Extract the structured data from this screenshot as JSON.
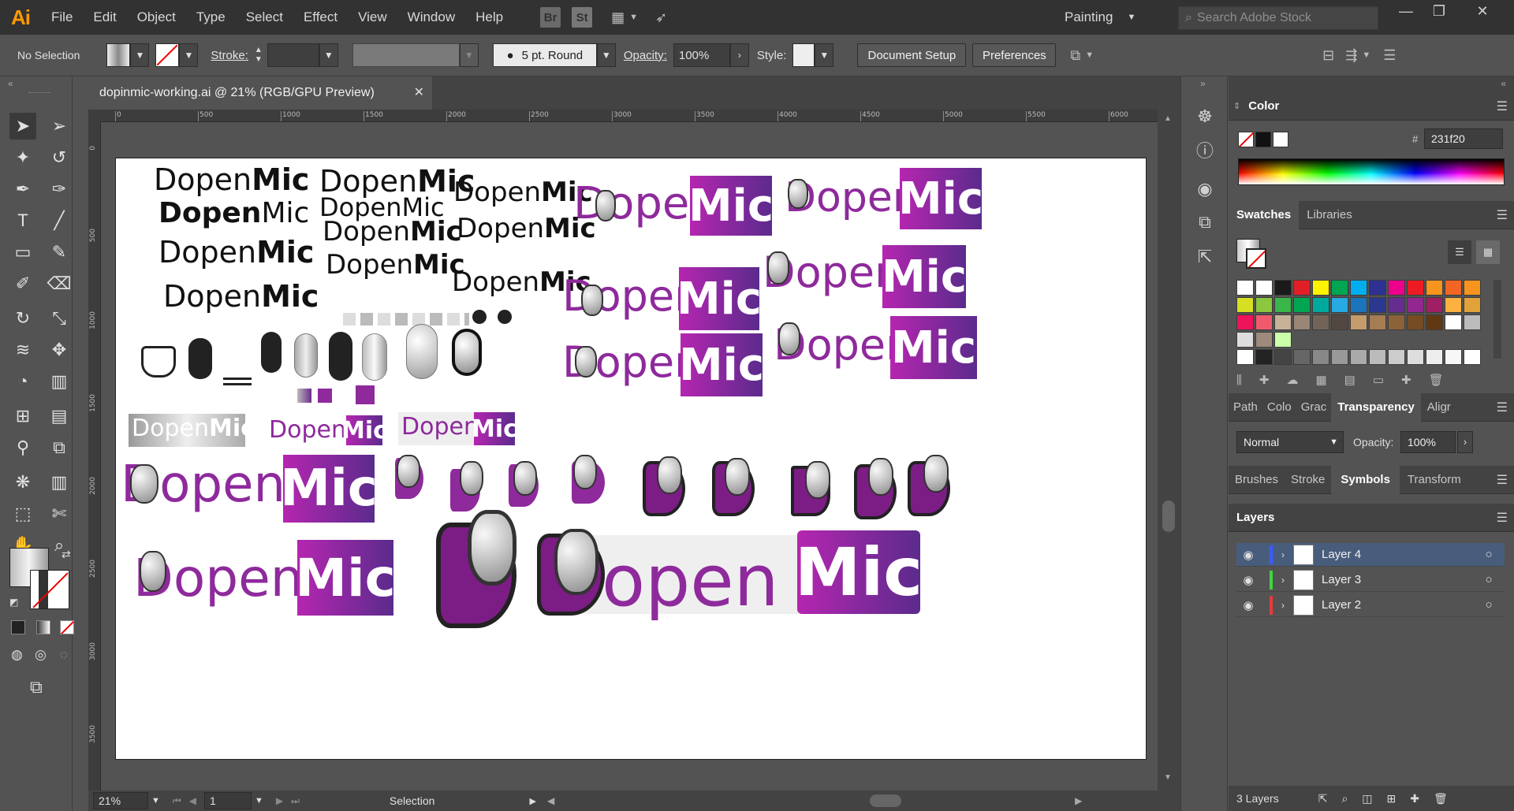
{
  "app": {
    "logo": "Ai"
  },
  "menu": [
    "File",
    "Edit",
    "Object",
    "Type",
    "Select",
    "Effect",
    "View",
    "Window",
    "Help"
  ],
  "bridge_buttons": [
    "Br",
    "St"
  ],
  "workspace": "Painting",
  "search": {
    "placeholder": "Search Adobe Stock"
  },
  "control_bar": {
    "selection_label": "No Selection",
    "stroke_label": "Stroke:",
    "brush_label": "5 pt. Round",
    "opacity_label": "Opacity:",
    "opacity_value": "100%",
    "style_label": "Style:",
    "document_setup": "Document Setup",
    "preferences": "Preferences"
  },
  "document": {
    "tab_title": "dopinmic-working.ai @ 21% (RGB/GPU Preview)"
  },
  "ruler_h": [
    "0",
    "500",
    "1000",
    "1500",
    "2000",
    "2500",
    "3000",
    "3500",
    "4000",
    "4500",
    "5000",
    "5500",
    "6000"
  ],
  "ruler_v": [
    "0",
    "500",
    "1000",
    "1500",
    "2000",
    "2500",
    "3000",
    "3500"
  ],
  "status": {
    "zoom": "21%",
    "artboard": "1",
    "tool": "Selection"
  },
  "panels": {
    "color": {
      "title": "Color",
      "hex_label": "#",
      "hex_value": "231f20"
    },
    "swatches": {
      "tabs": [
        "Swatches",
        "Libraries"
      ]
    },
    "transparency": {
      "tabs": [
        "Path",
        "Colo",
        "Grac",
        "Transparency",
        "Aligr"
      ],
      "blend_mode": "Normal",
      "opacity_label": "Opacity:",
      "opacity_value": "100%"
    },
    "symbols": {
      "tabs": [
        "Brushes",
        "Stroke",
        "Symbols",
        "Transform"
      ]
    },
    "layers": {
      "title": "Layers",
      "rows": [
        {
          "name": "Layer 4",
          "color": "#3b5bff",
          "selected": true
        },
        {
          "name": "Layer 3",
          "color": "#3fd43f",
          "selected": false
        },
        {
          "name": "Layer 2",
          "color": "#e83a3a",
          "selected": false
        }
      ],
      "count": "3 Layers"
    }
  },
  "artwork": {
    "word_dopen": "Dopen",
    "word_mic": "Mic",
    "word_dopen_lower": "opeN",
    "word_open": "open",
    "brand_colors": {
      "purple": "#8e2a9c",
      "purple_dark": "#5b2b8c",
      "magenta": "#b526b0"
    }
  },
  "icons": [
    "selection-tool",
    "direct-selection-tool",
    "magic-wand",
    "lasso",
    "pen",
    "curvature",
    "type",
    "line",
    "rectangle",
    "paintbrush",
    "shaper",
    "eraser",
    "rotate",
    "scale",
    "warp",
    "free-transform",
    "shape-builder",
    "perspective",
    "mesh",
    "gradient",
    "eyedropper",
    "blend",
    "symbol-sprayer",
    "column-graph",
    "artboard",
    "slice",
    "hand",
    "zoom"
  ]
}
